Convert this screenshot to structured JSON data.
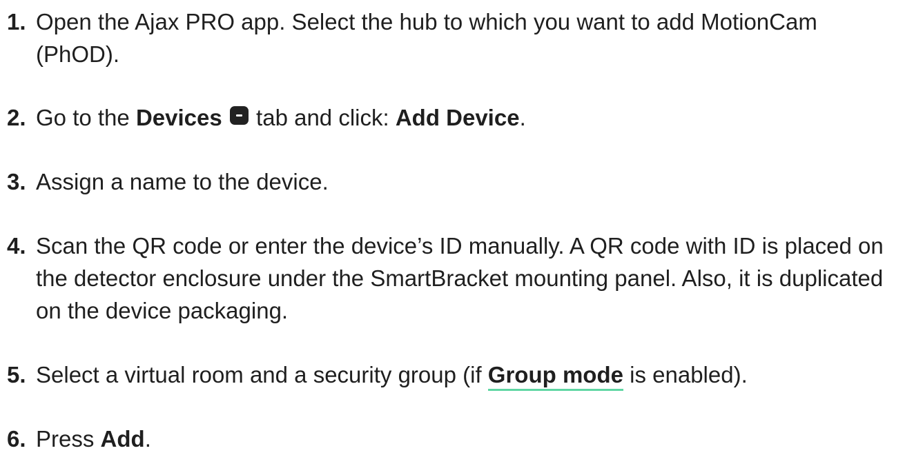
{
  "steps": [
    {
      "num": "1.",
      "text": "Open the Ajax PRO app. Select the hub to which you want to add MotionCam (PhOD)."
    },
    {
      "num": "2.",
      "pre": "Go to the ",
      "bold1": "Devices",
      "mid": " tab and click: ",
      "bold2": "Add Device",
      "end": "."
    },
    {
      "num": "3.",
      "text": "Assign a name to the device."
    },
    {
      "num": "4.",
      "text": "Scan the QR code or enter the device’s ID manually. A QR code with ID is placed on the detector enclosure under the SmartBracket mounting panel. Also, it is duplicated on the device packaging."
    },
    {
      "num": "5.",
      "pre": "Select a virtual room and a security group (if ",
      "link": "Group mode",
      "end": " is enabled)."
    },
    {
      "num": "6.",
      "pre": "Press ",
      "bold1": "Add",
      "end": "."
    }
  ],
  "icons": {
    "devices_tab": "devices-tab-icon"
  },
  "colors": {
    "link_underline": "#5fd6a3",
    "text": "#1f1f1f"
  }
}
